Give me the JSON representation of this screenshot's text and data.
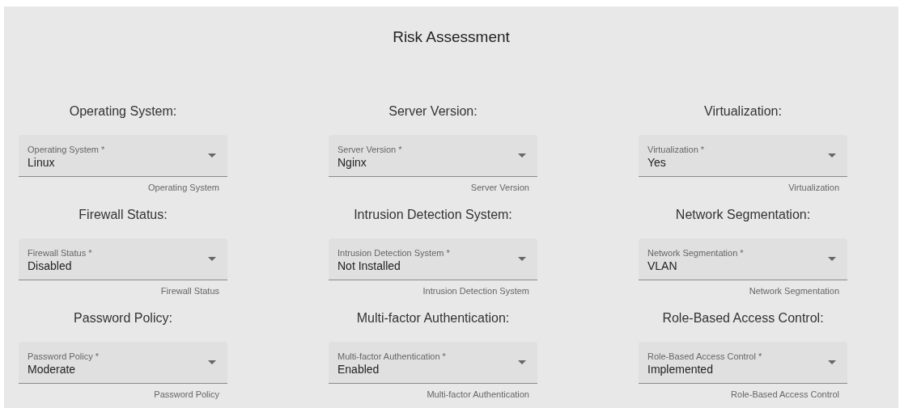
{
  "title": "Risk Assessment",
  "fields": [
    {
      "heading": "Operating System:",
      "label": "Operating System *",
      "value": "Linux",
      "helper": "Operating System"
    },
    {
      "heading": "Server Version:",
      "label": "Server Version *",
      "value": "Nginx",
      "helper": "Server Version"
    },
    {
      "heading": "Virtualization:",
      "label": "Virtualization *",
      "value": "Yes",
      "helper": "Virtualization"
    },
    {
      "heading": "Firewall Status:",
      "label": "Firewall Status *",
      "value": "Disabled",
      "helper": "Firewall Status"
    },
    {
      "heading": "Intrusion Detection System:",
      "label": "Intrusion Detection System *",
      "value": "Not Installed",
      "helper": "Intrusion Detection System"
    },
    {
      "heading": "Network Segmentation:",
      "label": "Network Segmentation *",
      "value": "VLAN",
      "helper": "Network Segmentation"
    },
    {
      "heading": "Password Policy:",
      "label": "Password Policy *",
      "value": "Moderate",
      "helper": "Password Policy"
    },
    {
      "heading": "Multi-factor Authentication:",
      "label": "Multi-factor Authentication *",
      "value": "Enabled",
      "helper": "Multi-factor Authentication"
    },
    {
      "heading": "Role-Based Access Control:",
      "label": "Role-Based Access Control *",
      "value": "Implemented",
      "helper": "Role-Based Access Control"
    }
  ]
}
